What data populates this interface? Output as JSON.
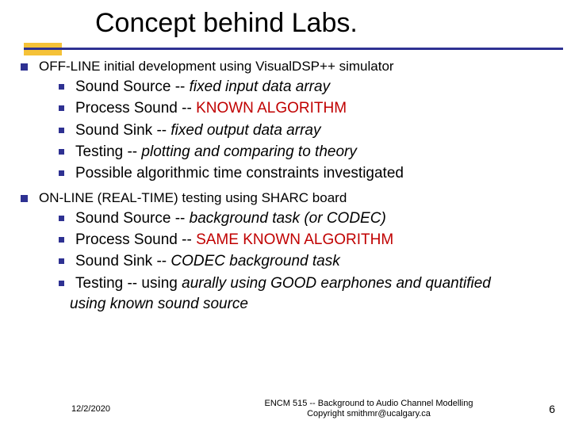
{
  "title": "Concept behind Labs.",
  "section1": {
    "heading": "OFF-LINE initial development using VisualDSP++ simulator",
    "items": [
      {
        "lead": "Sound Source -- ",
        "tail": "fixed input data array",
        "tailClass": "ital"
      },
      {
        "lead": "Process Sound -- ",
        "tail": "KNOWN ALGORITHM",
        "tailClass": "red"
      },
      {
        "lead": "Sound Sink -- ",
        "tail": "fixed output data array",
        "tailClass": "ital"
      },
      {
        "lead": "Testing -- ",
        "tail": "plotting and comparing to theory",
        "tailClass": "ital"
      },
      {
        "lead": "Possible algorithmic time constraints investigated",
        "tail": "",
        "tailClass": ""
      }
    ]
  },
  "section2": {
    "heading": "ON-LINE (REAL-TIME) testing using SHARC board",
    "items": [
      {
        "lead": "Sound Source -- ",
        "tail": "background task (or CODEC)",
        "tailClass": "ital"
      },
      {
        "lead": "Process Sound -- ",
        "tail": "SAME KNOWN ALGORITHM",
        "tailClass": "red"
      },
      {
        "lead": "Sound Sink -- ",
        "tail": "CODEC background task",
        "tailClass": "ital"
      },
      {
        "lead": "Testing -- using ",
        "tail": "aurally using GOOD earphones and quantified",
        "tailClass": "ital"
      }
    ],
    "trailing": "using known sound source"
  },
  "footer": {
    "date": "12/2/2020",
    "center1": "ENCM 515 -- Background to Audio Channel Modelling",
    "center2": "Copyright smithmr@ucalgary.ca",
    "page": "6"
  }
}
